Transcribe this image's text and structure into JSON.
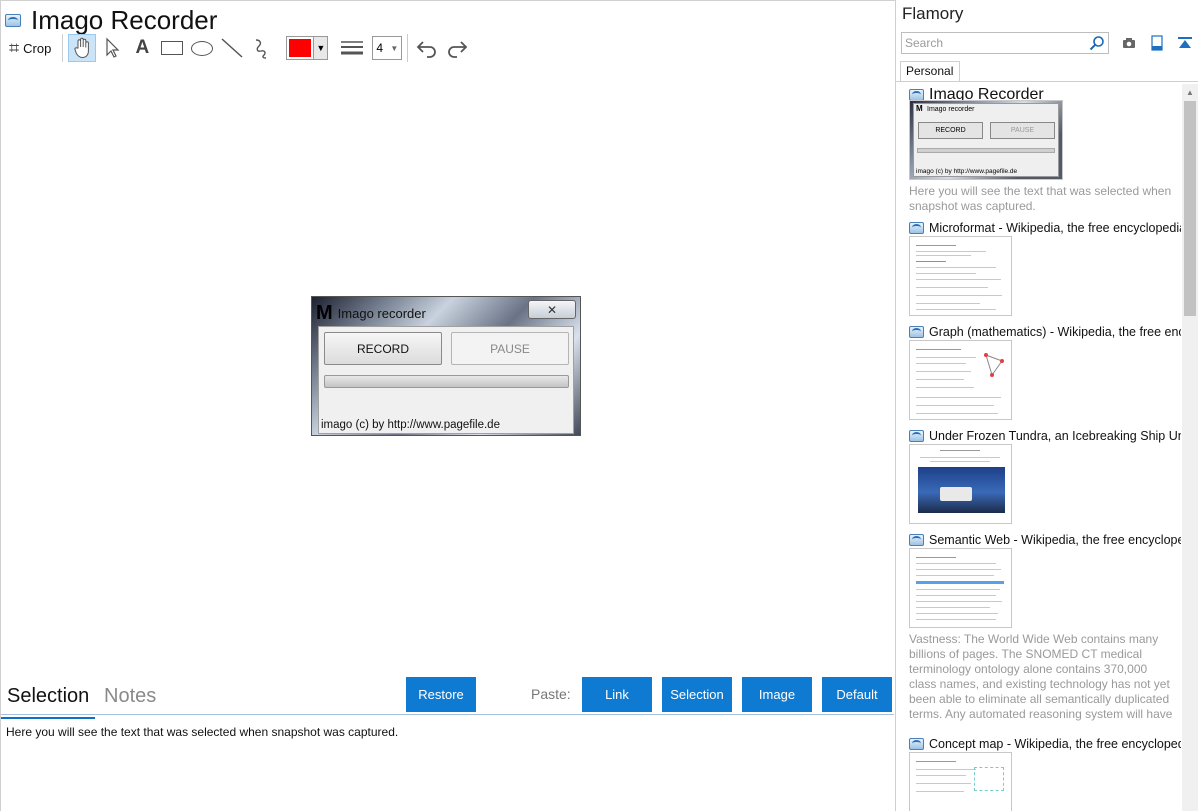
{
  "app": {
    "title": "Imago Recorder",
    "accent": "#0f7ad2"
  },
  "toolbar": {
    "crop_label": "Crop",
    "text_tool_glyph": "A",
    "color_value": "#ff0000",
    "line_width": "4",
    "icons": [
      "crop-icon",
      "hand-icon",
      "pointer-icon",
      "text-icon",
      "rectangle-icon",
      "ellipse-icon",
      "line-icon",
      "freehand-icon",
      "color-picker",
      "line-width-icon",
      "undo-icon",
      "redo-icon"
    ]
  },
  "preview": {
    "m_glyph": "M",
    "window_title": "Imago recorder",
    "close_glyph": "✕",
    "record_label": "RECORD",
    "pause_label": "PAUSE",
    "status_text": "imago (c) by http://www.pagefile.de"
  },
  "bottom": {
    "tab_selection": "Selection",
    "tab_notes": "Notes",
    "restore_label": "Restore",
    "paste_label": "Paste:",
    "link_label": "Link",
    "selection_label": "Selection",
    "image_label": "Image",
    "default_label": "Default",
    "selection_text": "Here you will see the text that was selected when snapshot was captured."
  },
  "side": {
    "title": "Flamory",
    "search_placeholder": "Search",
    "tab_personal": "Personal",
    "entries": [
      {
        "title": "Imago Recorder",
        "note": "Here you will see the text that was selected when snapshot was captured."
      },
      {
        "title": "Microformat - Wikipedia, the free encyclopedia"
      },
      {
        "title": "Graph (mathematics) - Wikipedia, the free encyclopedia"
      },
      {
        "title": "Under Frozen Tundra, an Icebreaking Ship Uncovers..."
      },
      {
        "title": "Semantic Web - Wikipedia, the free encyclopedia",
        "note": "Vastness: The World Wide Web contains many billions of pages. The SNOMED CT medical terminology ontology alone contains 370,000 class names, and existing technology has not yet been able to eliminate all semantically duplicated terms. Any automated reasoning system will have to deal with truly huge inputs."
      },
      {
        "title": "Concept map - Wikipedia, the free encyclopedia"
      }
    ],
    "thumb1": {
      "m_glyph": "M",
      "window_title": "Imago recorder",
      "record_label": "RECORD",
      "pause_label": "PAUSE",
      "status_text": "imago (c) by http://www.pagefile.de"
    }
  }
}
